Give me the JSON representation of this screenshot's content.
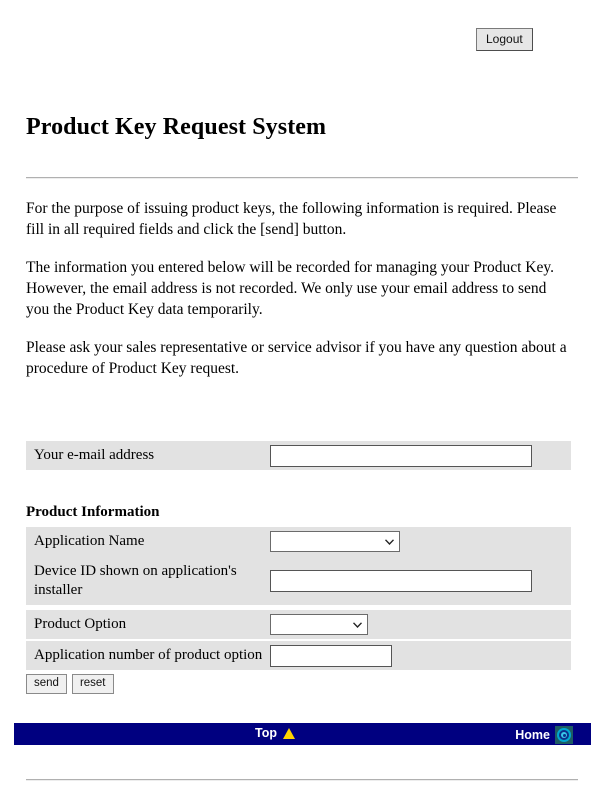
{
  "header": {
    "logout_label": "Logout",
    "title": "Product Key Request System"
  },
  "intro": {
    "paragraph1": "For the purpose of issuing product keys, the following information is required. Please fill in all required fields and click the [send] button.",
    "paragraph2": "The information you entered below will be recorded for managing your Product Key. However, the email address is not recorded. We only use your email address to send you the Product Key data temporarily.",
    "paragraph3": "Please ask your sales representative or service advisor if you have any question about a procedure of Product Key request."
  },
  "form": {
    "email_label": "Your e-mail address",
    "email_value": "",
    "section_heading": "Product Information",
    "rows": [
      {
        "label": "Application Name",
        "type": "select",
        "value": ""
      },
      {
        "label": "Device ID shown on application's installer",
        "type": "text",
        "value": ""
      },
      {
        "label": "Product Option",
        "type": "select",
        "value": ""
      },
      {
        "label": "Application number of product option",
        "type": "text",
        "value": ""
      }
    ],
    "send_label": "send",
    "reset_label": "reset"
  },
  "footer": {
    "top_label": "Top",
    "home_label": "Home"
  },
  "colors": {
    "navbar": "#000080",
    "row_background": "#e2e2e2",
    "triangle": "#ffd400"
  }
}
